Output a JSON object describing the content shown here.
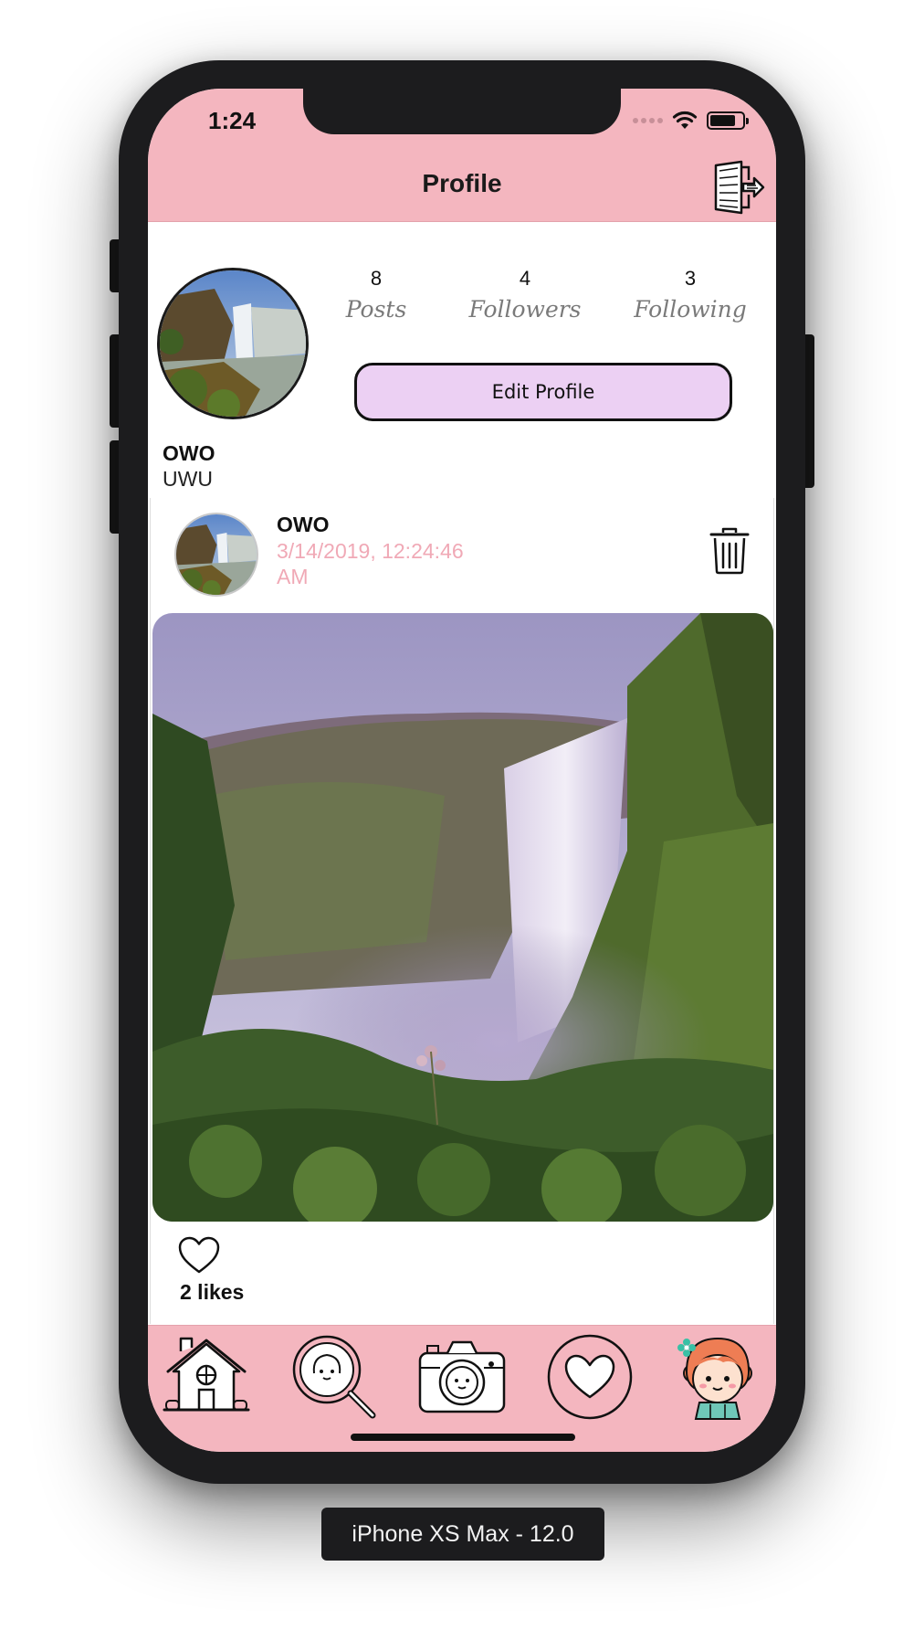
{
  "status_bar": {
    "time": "1:24"
  },
  "nav": {
    "title": "Profile",
    "logout_icon": "logout-door-icon"
  },
  "profile": {
    "name": "OWO",
    "handle": "UWU",
    "stats": {
      "posts_count": "8",
      "posts_label": "Posts",
      "followers_count": "4",
      "followers_label": "Followers",
      "following_count": "3",
      "following_label": "Following"
    },
    "edit_button_label": "Edit Profile"
  },
  "post": {
    "author": "OWO",
    "date": "3/14/2019, 12:24:46 AM",
    "likes": "2 likes"
  },
  "tabs": [
    "home-house-icon",
    "search-magnifier-icon",
    "camera-icon",
    "heart-activity-icon",
    "profile-girl-icon"
  ],
  "device_label": "iPhone XS Max - 12.0",
  "colors": {
    "accent_pink": "#f4b6bf",
    "edit_button_bg": "#ecd0f3",
    "date_text": "#f0a9b6",
    "frame": "#1c1c1e"
  }
}
